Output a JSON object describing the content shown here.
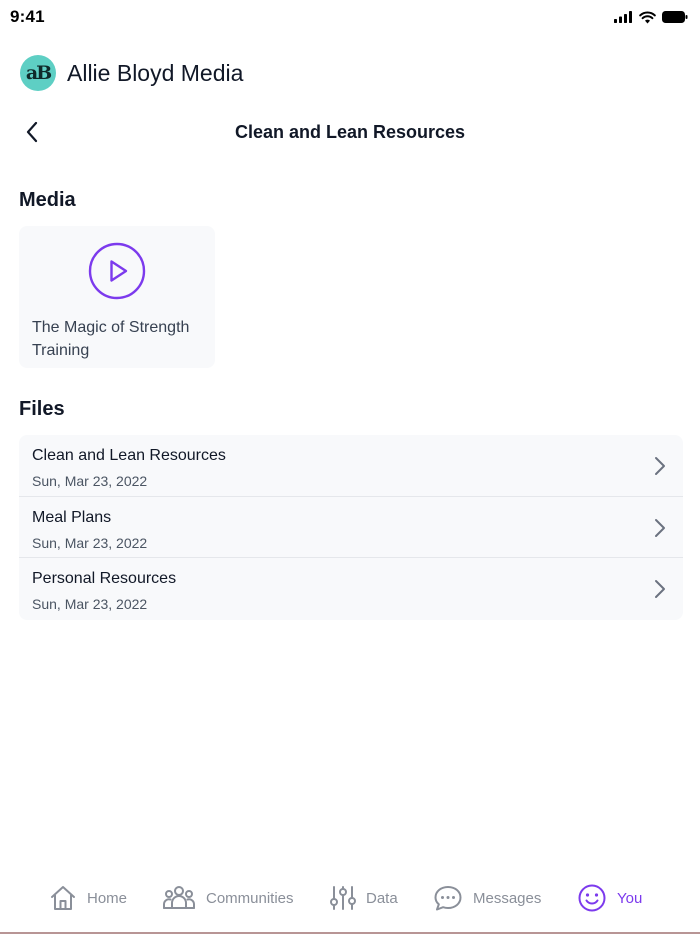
{
  "status_bar": {
    "time": "9:41",
    "icons": [
      "signal-icon",
      "wifi-icon",
      "battery-icon"
    ]
  },
  "brand": {
    "logo_text": "aB",
    "name": "Allie Bloyd Media",
    "logo_color": "#5ecfc4"
  },
  "header": {
    "title": "Clean and Lean Resources",
    "back_icon": "chevron-left-icon"
  },
  "media": {
    "section_title": "Media",
    "items": [
      {
        "title": "The Magic of Strength Training",
        "icon": "play-icon"
      }
    ]
  },
  "files": {
    "section_title": "Files",
    "items": [
      {
        "name": "Clean and Lean Resources",
        "date": "Sun, Mar 23, 2022"
      },
      {
        "name": "Meal Plans",
        "date": "Sun, Mar 23, 2022"
      },
      {
        "name": "Personal Resources",
        "date": "Sun, Mar 23, 2022"
      }
    ]
  },
  "tab_bar": {
    "items": [
      {
        "label": "Home",
        "icon": "home-icon",
        "active": false
      },
      {
        "label": "Communities",
        "icon": "users-icon",
        "active": false
      },
      {
        "label": "Data",
        "icon": "sliders-icon",
        "active": false
      },
      {
        "label": "Messages",
        "icon": "chat-bubble-icon",
        "active": false
      },
      {
        "label": "You",
        "icon": "smiley-icon",
        "active": true
      }
    ]
  },
  "colors": {
    "accent": "#7c3aed",
    "inactive": "#8a8f99",
    "card_bg": "#f8f9fb"
  }
}
